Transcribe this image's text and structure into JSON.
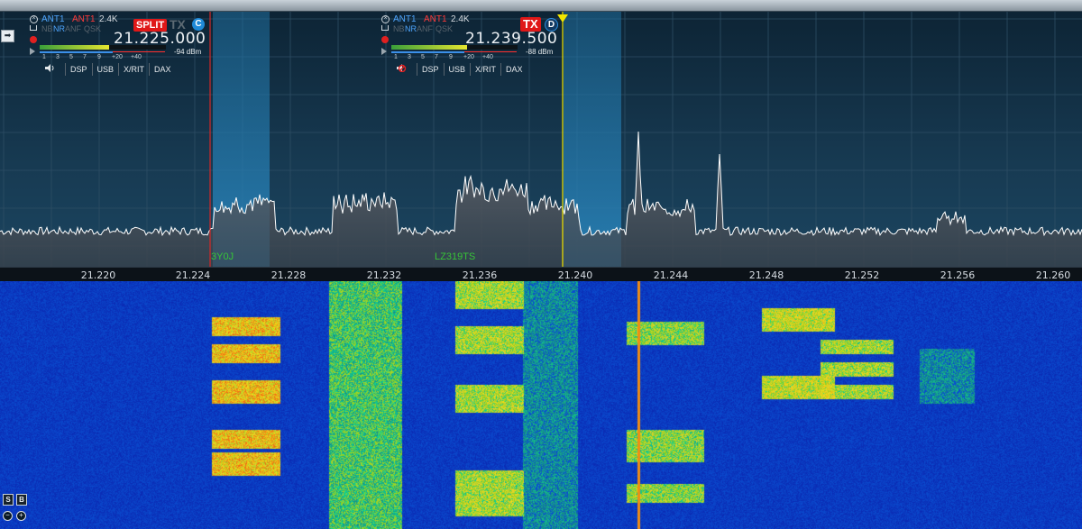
{
  "panadapter": {
    "axis_labels": [
      "21.220",
      "21.224",
      "21.228",
      "21.232",
      "21.236",
      "21.240",
      "21.244",
      "21.248",
      "21.252",
      "21.256",
      "21.260"
    ],
    "spots": [
      "3Y0J",
      "LZ319TS"
    ],
    "colors": {
      "background": "#13324a",
      "grid": "#2e4e64",
      "trace": "#ffffff",
      "passband": "#2c8ac4",
      "tx_marker": "#f2e600",
      "rx_marker": "#e02a2a",
      "spot": "#37c437"
    }
  },
  "slice_c": {
    "ant_rx": "ANT1",
    "ant_tx": "ANT1",
    "bandwidth": "2.4K",
    "flags": [
      "NB",
      "NR",
      "ANF",
      "QSK"
    ],
    "split_label": "SPLIT",
    "tx_label": "TX",
    "letter": "C",
    "frequency": "21.225.000",
    "signal_dbm": "-94 dBm",
    "scale": [
      "1",
      "3",
      "5",
      "7",
      "9",
      "+20",
      "+40"
    ],
    "signal_level_percent": 55,
    "buttons": [
      "DSP",
      "USB",
      "X/RIT",
      "DAX"
    ],
    "speaker_icon": "speaker-icon"
  },
  "slice_d": {
    "ant_rx": "ANT1",
    "ant_tx": "ANT1",
    "bandwidth": "2.4K",
    "flags": [
      "NB",
      "NR",
      "ANF",
      "QSK"
    ],
    "tx_label": "TX",
    "letter": "D",
    "frequency": "21.239.500",
    "signal_dbm": "-88 dBm",
    "scale": [
      "1",
      "3",
      "5",
      "7",
      "9",
      "+20",
      "+40"
    ],
    "signal_level_percent": 60,
    "buttons": [
      "DSP",
      "USB",
      "X/RIT",
      "DAX"
    ],
    "speaker_icon": "speaker-muted-icon"
  },
  "controls": {
    "side_toggle": "➡",
    "wf_buttons": [
      "S",
      "B"
    ],
    "zoom_out": "−",
    "zoom_in": "+"
  }
}
